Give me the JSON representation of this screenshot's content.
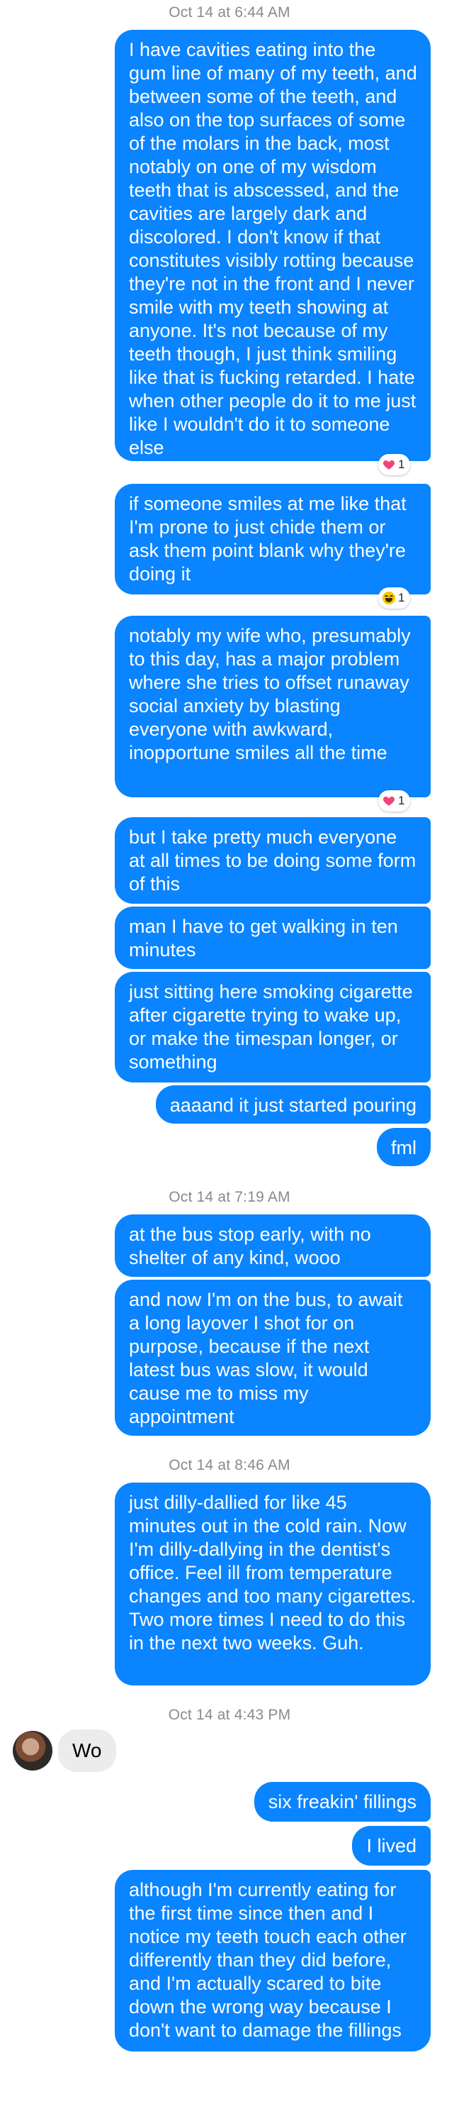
{
  "timestamps": [
    "Oct 14 at 6:44 AM",
    "Oct 14 at 7:19 AM",
    "Oct 14 at 8:46 AM",
    "Oct 14 at 4:43 PM"
  ],
  "messages": [
    "I have cavities eating into the gum line of many of my teeth, and between some of the teeth, and also on the top surfaces of some of the molars in the back, most notably on one of my wisdom teeth that is abscessed, and the cavities are largely dark and discolored. I don't know if that constitutes visibly rotting because they're not in the front and I never smile with my teeth showing at anyone. It's not because of my teeth though, I just think smiling like that is fucking retarded. I hate when other people do it to me just like I wouldn't do it to someone else",
    "if someone smiles at me like that I'm prone to just chide them or ask them point blank why they're doing it",
    "notably my wife who, presumably to this day, has a major problem where she tries to offset runaway social anxiety by blasting everyone with awkward, inopportune smiles all the time",
    "but I take pretty much everyone at all times to be doing some form of this",
    "man I have to get walking in ten minutes",
    "just sitting here smoking cigarette after cigarette trying to wake up, or make the timespan longer, or something",
    "aaaand it just started pouring",
    "fml",
    "at the bus stop early, with no shelter of any kind, wooo",
    "and now I'm on the bus, to await a long layover I shot for on purpose, because if the next latest bus was slow, it would cause me to miss my appointment",
    "just dilly-dallied for like 45 minutes out in the cold rain. Now I'm dilly-dallying in the dentist's office. Feel ill from temperature changes and too many cigarettes. Two more times I need to do this in the next two weeks. Guh.",
    "six freakin' fillings",
    "I lived",
    "although I'm currently eating for the first time since then and I notice my teeth touch each other differently than they did before, and I'm actually scared to bite down the wrong way because I don't want to damage the fillings"
  ],
  "received": [
    "Wo"
  ],
  "reactions": [
    {
      "icon": "heart-icon",
      "count": "1"
    },
    {
      "icon": "laugh-icon",
      "count": "1"
    },
    {
      "icon": "heart-icon",
      "count": "1"
    }
  ],
  "colors": {
    "sent_bubble": "#0a84ff",
    "received_bubble": "#ececec",
    "timestamp": "#8a8a8a"
  }
}
